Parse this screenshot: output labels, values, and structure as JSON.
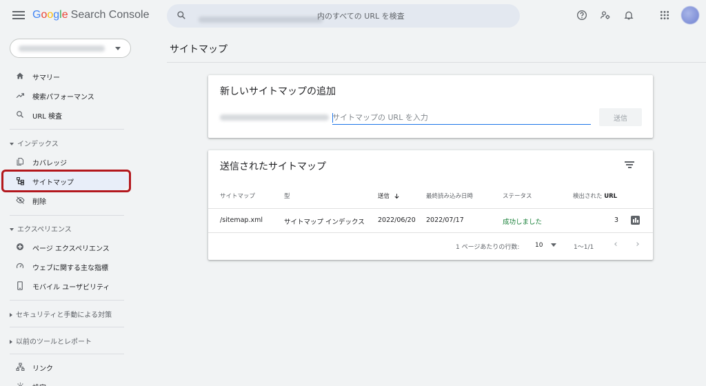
{
  "app": {
    "logo_google": [
      "G",
      "o",
      "o",
      "g",
      "l",
      "e"
    ],
    "logo_product": "Search Console"
  },
  "search": {
    "placeholder": "内のすべての URL を検査"
  },
  "page": {
    "title": "サイトマップ"
  },
  "sidebar": {
    "top_items": [
      {
        "label": "サマリー",
        "icon": "home-icon"
      },
      {
        "label": "検索パフォーマンス",
        "icon": "trending-up-icon"
      },
      {
        "label": "URL 検査",
        "icon": "search-icon"
      }
    ],
    "index_section": "インデックス",
    "index_items": [
      {
        "label": "カバレッジ",
        "icon": "file-copy-icon"
      },
      {
        "label": "サイトマップ",
        "icon": "sitemap-icon",
        "active": true
      },
      {
        "label": "削除",
        "icon": "visibility-off-icon"
      }
    ],
    "experience_section": "エクスペリエンス",
    "experience_items": [
      {
        "label": "ページ エクスペリエンス",
        "icon": "page-experience-icon"
      },
      {
        "label": "ウェブに関する主な指標",
        "icon": "speed-icon"
      },
      {
        "label": "モバイル ユーザビリティ",
        "icon": "smartphone-icon"
      }
    ],
    "security_section": "セキュリティと手動による対策",
    "legacy_section": "以前のツールとレポート",
    "bottom_items": [
      {
        "label": "リンク",
        "icon": "links-icon"
      },
      {
        "label": "設定",
        "icon": "settings-icon"
      }
    ]
  },
  "add_sitemap": {
    "title": "新しいサイトマップの追加",
    "input_placeholder": "サイトマップの URL を入力",
    "submit_label": "送信"
  },
  "submitted": {
    "title": "送信されたサイトマップ",
    "columns": {
      "sitemap": "サイトマップ",
      "type": "型",
      "submitted": "送信",
      "last_read": "最終読み込み日時",
      "status": "ステータス",
      "discovered_prefix": "検出された",
      "discovered_suffix": "URL"
    },
    "rows": [
      {
        "sitemap": "/sitemap.xml",
        "type": "サイトマップ インデックス",
        "submitted": "2022/06/20",
        "last_read": "2022/07/17",
        "status": "成功しました",
        "discovered": "3"
      }
    ],
    "pagination": {
      "rows_per_page_label": "1 ページあたりの行数:",
      "rows_per_page": "10",
      "range": "1〜1/1"
    }
  },
  "colors": {
    "accent": "#1a73e8",
    "success": "#188038",
    "highlight_box": "#b3171d",
    "active_nav": "#e8eef9"
  }
}
